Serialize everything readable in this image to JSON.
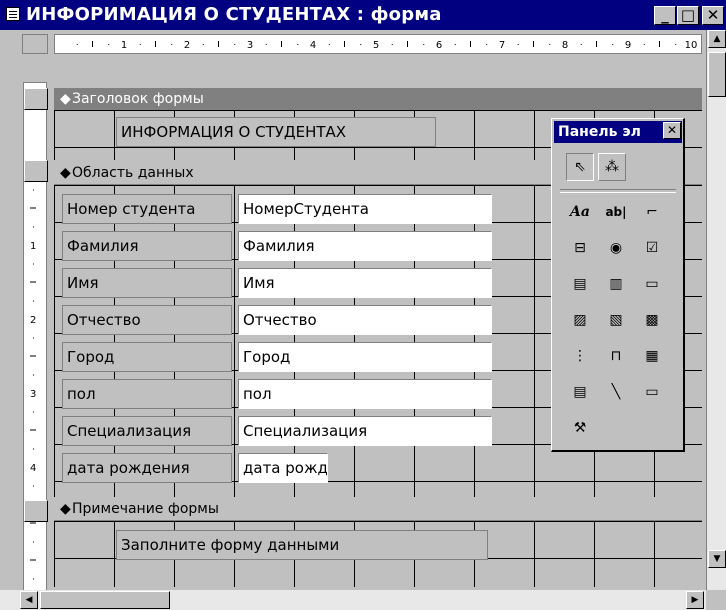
{
  "window": {
    "title": "ИНФОРИМАЦИЯ О СТУДЕНТАХ : форма",
    "minimize_glyph": "_",
    "maximize_glyph": "□",
    "close_glyph": "✕"
  },
  "ruler": {
    "horizontal_marks": [
      "1",
      "2",
      "3",
      "4",
      "5",
      "6",
      "7",
      "8",
      "9",
      "10"
    ],
    "vertical_marks": [
      "1",
      "2",
      "3",
      "4"
    ]
  },
  "sections": {
    "header_label": "Заголовок формы",
    "detail_label": "Область данных",
    "footer_label": "Примечание формы"
  },
  "form_header": {
    "title_text": "ИНФОРМАЦИЯ О СТУДЕНТАХ"
  },
  "fields": [
    {
      "label": "Номер студента",
      "control": "НомерСтудента"
    },
    {
      "label": "Фамилия",
      "control": "Фамилия"
    },
    {
      "label": "Имя",
      "control": "Имя"
    },
    {
      "label": "Отчество",
      "control": "Отчество"
    },
    {
      "label": "Город",
      "control": "Город"
    },
    {
      "label": "пол",
      "control": "пол"
    },
    {
      "label": "Специализация",
      "control": "Специализация"
    },
    {
      "label": "дата рождения",
      "control": "дата рожд"
    }
  ],
  "form_footer": {
    "note_text": "Заполните форму данными"
  },
  "toolbox": {
    "title": "Панель эл",
    "close_glyph": "✕",
    "tools": [
      {
        "name": "select-objects-icon",
        "glyph": "⇖"
      },
      {
        "name": "control-wizards-icon",
        "glyph": "⁂"
      },
      {
        "name": "label-tool-icon",
        "glyph": "Aa"
      },
      {
        "name": "text-box-tool-icon",
        "glyph": "ab|"
      },
      {
        "name": "option-group-tool-icon",
        "glyph": "⌐"
      },
      {
        "name": "toggle-button-tool-icon",
        "glyph": "⊟"
      },
      {
        "name": "option-button-tool-icon",
        "glyph": "◉"
      },
      {
        "name": "check-box-tool-icon",
        "glyph": "☑"
      },
      {
        "name": "combo-box-tool-icon",
        "glyph": "▤"
      },
      {
        "name": "list-box-tool-icon",
        "glyph": "▥"
      },
      {
        "name": "command-button-tool-icon",
        "glyph": "▭"
      },
      {
        "name": "image-tool-icon",
        "glyph": "▨"
      },
      {
        "name": "unbound-object-frame-icon",
        "glyph": "▧"
      },
      {
        "name": "bound-object-frame-icon",
        "glyph": "▩"
      },
      {
        "name": "page-break-tool-icon",
        "glyph": "⋮"
      },
      {
        "name": "tab-control-tool-icon",
        "glyph": "⊓"
      },
      {
        "name": "subform-tool-icon",
        "glyph": "▦"
      },
      {
        "name": "subform-report-tool-icon",
        "glyph": "▤"
      },
      {
        "name": "line-tool-icon",
        "glyph": "╲"
      },
      {
        "name": "rectangle-tool-icon",
        "glyph": "▭"
      },
      {
        "name": "more-controls-icon",
        "glyph": "⚒"
      }
    ]
  },
  "colors": {
    "titlebar": "#000080",
    "section_bar": "#808080",
    "face": "#c0c0c0"
  }
}
